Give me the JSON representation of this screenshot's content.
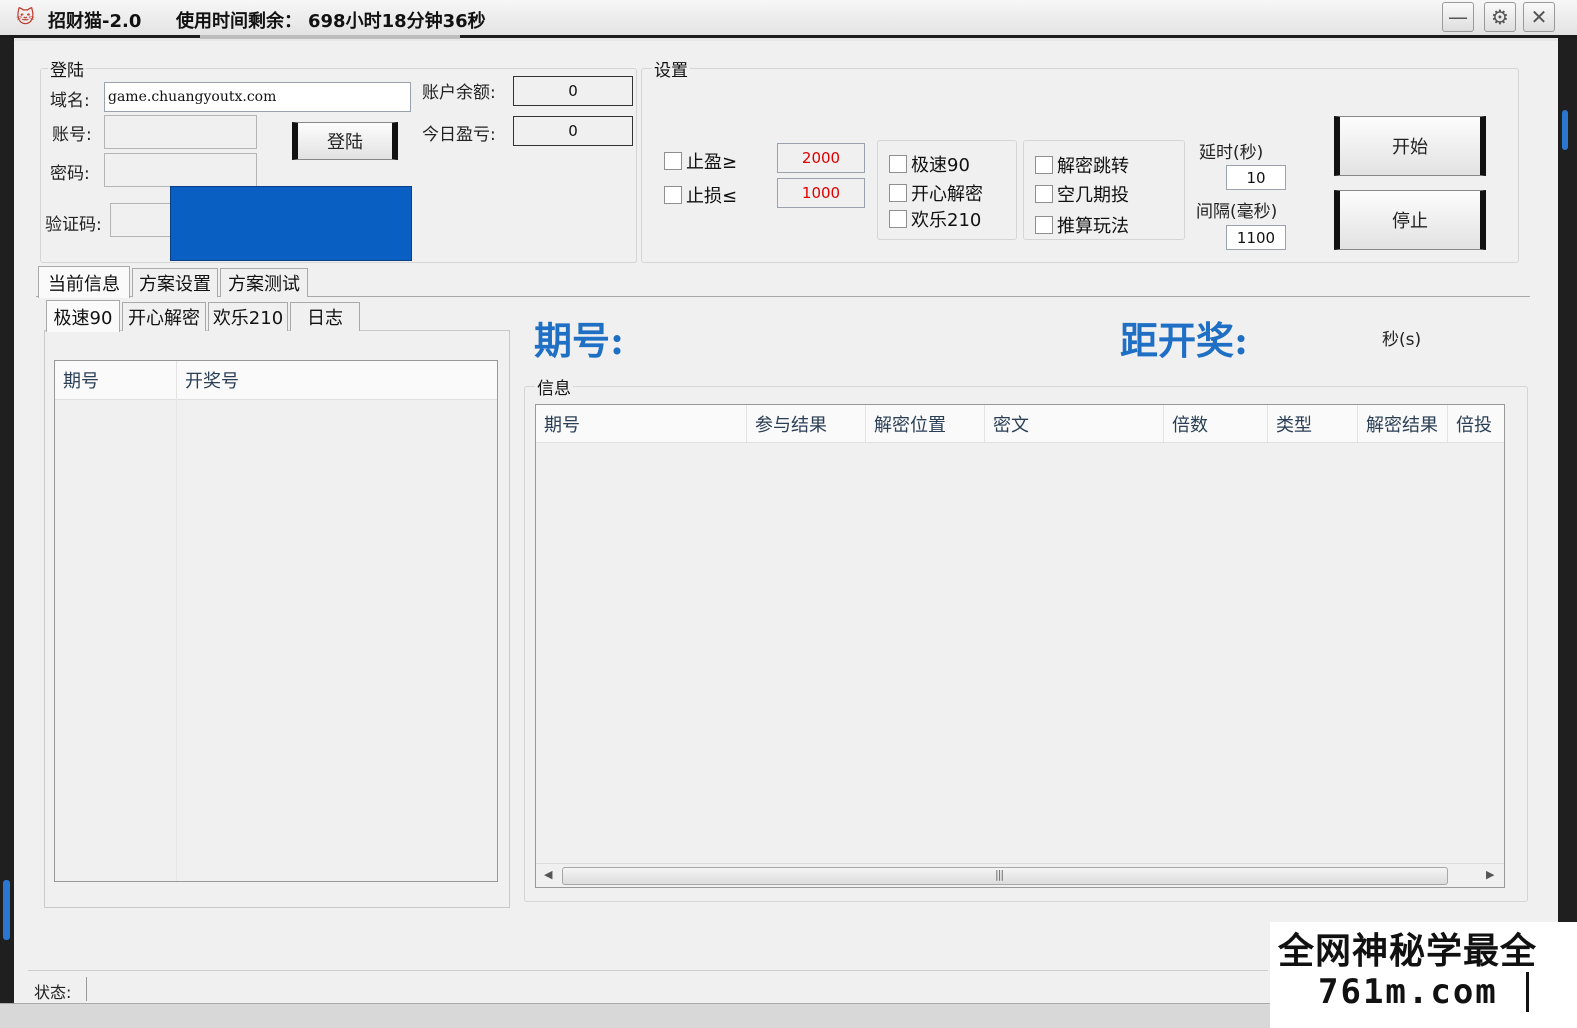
{
  "titlebar": {
    "app_title": "招财猫-2.0",
    "time_remaining_label": "使用时间剩余：",
    "time_remaining_value": "698小时18分钟36秒",
    "minimize": "—",
    "settings": "⚙",
    "close": "✕"
  },
  "login": {
    "group_label": "登陆",
    "domain_label": "域名:",
    "domain_value": "game.chuangyoutx.com",
    "account_label": "账号:",
    "password_label": "密码:",
    "captcha_label": "验证码:",
    "login_button": "登陆",
    "balance_label": "账户余额:",
    "balance_value": "0",
    "today_pl_label": "今日盈亏:",
    "today_pl_value": "0"
  },
  "settings": {
    "group_label": "设置",
    "stop_profit_label": "止盈≥",
    "stop_profit_value": "2000",
    "stop_loss_label": "止损≤",
    "stop_loss_value": "1000",
    "games": [
      "极速90",
      "开心解密",
      "欢乐210"
    ],
    "options": [
      "解密跳转",
      "空几期投",
      "推算玩法"
    ],
    "delay_label": "延时(秒)",
    "delay_value": "10",
    "interval_label": "间隔(毫秒)",
    "interval_value": "1100",
    "start_button": "开始",
    "stop_button": "停止"
  },
  "main_tabs": [
    "当前信息",
    "方案设置",
    "方案测试"
  ],
  "sub_tabs": [
    "极速90",
    "开心解密",
    "欢乐210",
    "日志"
  ],
  "draw_list": {
    "columns": [
      "期号",
      "开奖号"
    ]
  },
  "period_label": "期号:",
  "countdown_label": "距开奖:",
  "seconds_unit": "秒(s)",
  "info": {
    "group_label": "信息",
    "columns": [
      "期号",
      "参与结果",
      "解密位置",
      "密文",
      "倍数",
      "类型",
      "解密结果",
      "倍投"
    ]
  },
  "status": {
    "label": "状态:"
  },
  "watermark": {
    "line1": "全网神秘学最全",
    "line2": "761m.com"
  },
  "colors": {
    "accent_blue": "#1f6fc4",
    "captcha_blue": "#0a5fc2",
    "red_value": "#e00000"
  }
}
